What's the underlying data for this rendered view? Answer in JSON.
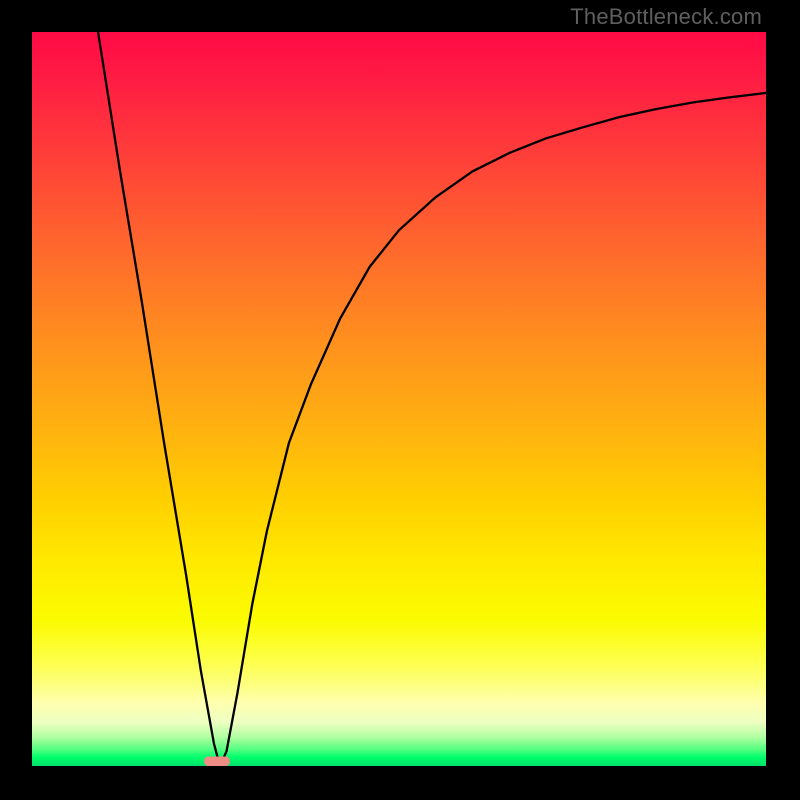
{
  "watermark_text": "TheBottleneck.com",
  "chart_data": {
    "type": "line",
    "title": "",
    "xlabel": "",
    "ylabel": "",
    "xlim": [
      0,
      100
    ],
    "ylim": [
      0,
      100
    ],
    "axes_visible": false,
    "grid": false,
    "legend": false,
    "background": "rainbow-gradient (red top → green bottom)",
    "series": [
      {
        "name": "bottleneck-curve",
        "color": "#000000",
        "x": [
          9,
          12,
          15,
          18,
          21,
          23,
          24.8,
          25.6,
          26.5,
          28,
          30,
          32,
          35,
          38,
          42,
          46,
          50,
          55,
          60,
          65,
          70,
          75,
          80,
          85,
          90,
          95,
          100
        ],
        "y": [
          100,
          81,
          63,
          44,
          26,
          13,
          3,
          0,
          2,
          10,
          22,
          32,
          44,
          52,
          61,
          68,
          73,
          77.5,
          81,
          83.5,
          85.5,
          87,
          88.4,
          89.5,
          90.4,
          91.1,
          91.7
        ]
      }
    ],
    "marker": {
      "name": "optimal-point",
      "shape": "rounded-rect",
      "color": "#ed8d84",
      "x": 25.2,
      "y": 0,
      "approx_width_pct": 3.5,
      "approx_height_pct": 1.3
    },
    "notes": "Values are visual estimates read from unlabeled axes; y=0 at bottom, y=100 at top."
  }
}
